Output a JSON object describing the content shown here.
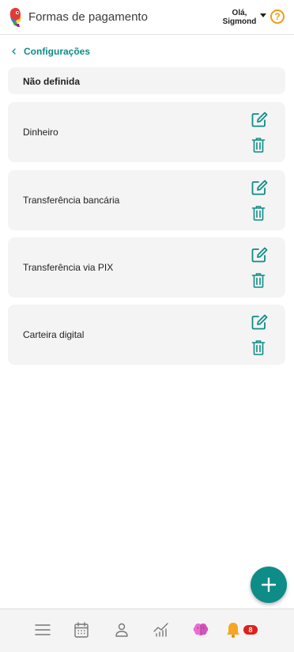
{
  "header": {
    "title": "Formas de pagamento",
    "greeting_line1": "Olá,",
    "greeting_line2": "Sigmond",
    "help_symbol": "?",
    "logo_icon": "parrot-logo-icon"
  },
  "breadcrumb": {
    "label": "Configurações"
  },
  "default_item": {
    "label": "Não definida"
  },
  "payment_methods": [
    {
      "label": "Dinheiro"
    },
    {
      "label": "Transferência bancária"
    },
    {
      "label": "Transferência via PIX"
    },
    {
      "label": "Carteira digital"
    }
  ],
  "bottom_nav": {
    "items": [
      "menu-icon",
      "calendar-icon",
      "user-icon",
      "chart-icon",
      "brain-icon",
      "bell-icon"
    ],
    "notification_count": "8"
  },
  "colors": {
    "accent": "#0e8c88",
    "help": "#f39c12",
    "badge": "#e0201a",
    "card_bg": "#f4f4f4"
  }
}
